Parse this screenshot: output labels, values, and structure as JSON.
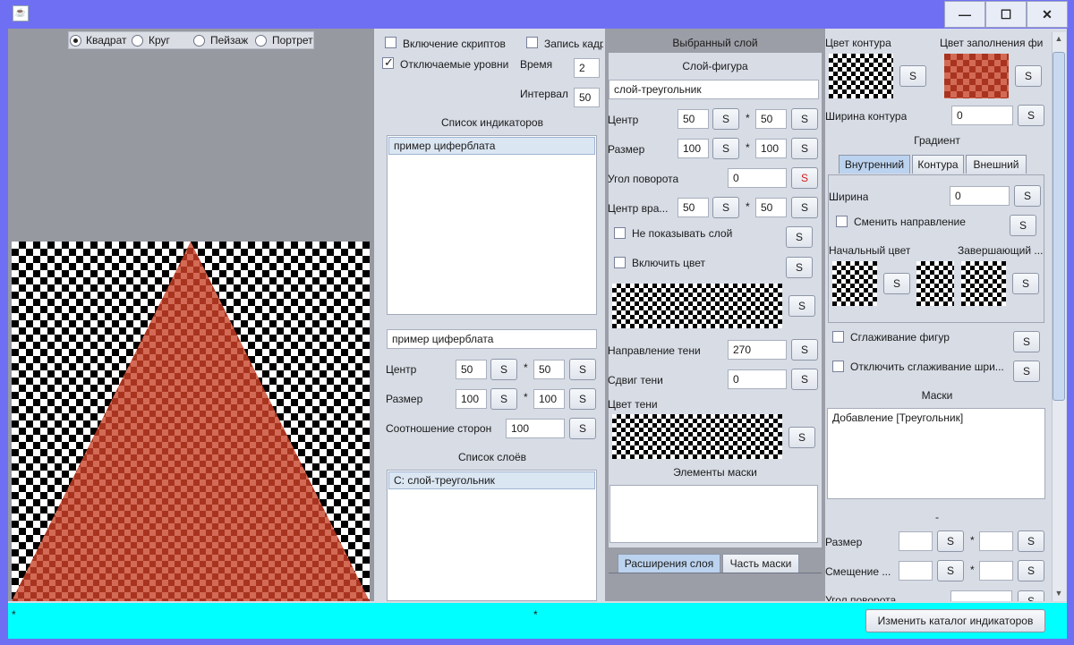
{
  "window": {
    "app_icon": "java-icon",
    "minimize": "—",
    "maximize": "☐",
    "close": "✕"
  },
  "preview": {
    "shape_options": [
      "Квадрат",
      "Круг",
      "Пейзаж",
      "Портрет"
    ],
    "selected_option": "Квадрат"
  },
  "left": {
    "enable_scripts": "Включение скриптов",
    "frame_record": "Запись кадр",
    "switchable_levels": "Отключаемые уровни",
    "time_label": "Время",
    "time_value": "2",
    "interval_label": "Интервал",
    "interval_value": "50",
    "indicators_title": "Список индикаторов",
    "indicators": [
      "пример циферблата"
    ],
    "indicator_name": "пример циферблата",
    "center_label": "Центр",
    "center_x": "50",
    "center_y": "50",
    "size_label": "Размер",
    "size_x": "100",
    "size_y": "100",
    "aspect_label": "Соотношение сторон",
    "aspect_value": "100",
    "layers_title": "Список слоёв",
    "layers": [
      "С: слой-треугольник"
    ],
    "s": "S",
    "star": "*"
  },
  "middle": {
    "header": "Выбранный слой",
    "subheader": "Слой-фигура",
    "layer_name": "слой-треугольник",
    "center_label": "Центр",
    "center_x": "50",
    "center_y": "50",
    "size_label": "Размер",
    "size_x": "100",
    "size_y": "100",
    "angle_label": "Угол поворота",
    "angle_value": "0",
    "rot_center_label": "Центр вра...",
    "rot_x": "50",
    "rot_y": "50",
    "hide_layer": "Не показывать слой",
    "enable_color": "Включить цвет",
    "shadow_dir_label": "Направление тени",
    "shadow_dir_value": "270",
    "shadow_shift_label": "Сдвиг тени",
    "shadow_shift_value": "0",
    "shadow_color_label": "Цвет тени",
    "mask_elements_title": "Элементы маски",
    "tabs": [
      "Расширения слоя",
      "Часть маски"
    ]
  },
  "right": {
    "outline_color_label": "Цвет контура",
    "fill_color_label": "Цвет заполнения фи",
    "outline_width_label": "Ширина контура",
    "outline_width_value": "0",
    "gradient_title": "Градиент",
    "gradient_tabs": [
      "Внутренний",
      "Контура",
      "Внешний"
    ],
    "width_label": "Ширина",
    "width_value": "0",
    "change_direction": "Сменить направление",
    "start_color_label": "Начальный цвет",
    "end_color_label": "Завершающий ...",
    "smooth_shapes": "Сглаживание фигур",
    "disable_font_smoothing": "Отключить сглаживание шри...",
    "masks_title": "Маски",
    "masks": [
      "Добавление [Треугольник]"
    ],
    "dash": "-",
    "size_label": "Размер",
    "offset_label": "Смещение ...",
    "angle_label": "Угол поворота"
  },
  "status": {
    "left_star": "*",
    "mid_star": "*",
    "change_catalog_button": "Изменить каталог индикаторов"
  },
  "colors": {
    "title_bar": "#6f6ff3",
    "status_bar": "#00ffff",
    "fill_red": "#a8341f"
  }
}
